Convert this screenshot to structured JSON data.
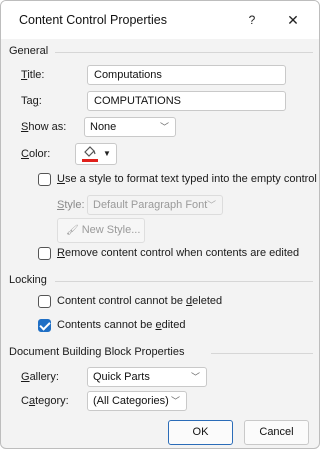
{
  "window": {
    "title": "Content Control Properties",
    "help_glyph": "?",
    "close_glyph": "✕"
  },
  "general": {
    "heading": "General",
    "title_label": {
      "u": "T",
      "rest": "itle:"
    },
    "title_value": "Computations",
    "tag_label": {
      "pre": "Ta",
      "u": "g",
      "rest": ":"
    },
    "tag_value": "COMPUTATIONS",
    "show_as_label": {
      "u": "S",
      "rest": "how as:"
    },
    "show_as_value": "None",
    "color_label": {
      "u": "C",
      "rest": "olor:"
    },
    "color_swatch": "#e0201b",
    "use_style_label": {
      "u": "U",
      "rest": "se a style to format text typed into the empty control"
    },
    "style_label": {
      "u": "S",
      "rest": "tyle:"
    },
    "style_value": "Default Paragraph Font",
    "new_style_label": {
      "u": "N",
      "rest": "ew Style..."
    },
    "remove_label": {
      "u": "R",
      "rest": "emove content control when contents are edited"
    }
  },
  "locking": {
    "heading": "Locking",
    "cannot_delete": {
      "pre": "Content control cannot be ",
      "u": "d",
      "rest": "eleted",
      "checked": false
    },
    "cannot_edit": {
      "pre": "Contents cannot be ",
      "u": "e",
      "rest": "dited",
      "checked": true
    }
  },
  "building_block": {
    "heading": "Document Building Block Properties",
    "gallery_label": {
      "u": "G",
      "rest": "allery:"
    },
    "gallery_value": "Quick Parts",
    "category_label": {
      "pre": "C",
      "u": "a",
      "rest": "tegory:"
    },
    "category_value": "(All Categories)"
  },
  "buttons": {
    "ok": "OK",
    "cancel": "Cancel"
  },
  "colors": {
    "accent": "#1f6fc5",
    "dialog_bg": "#f3f3f3"
  }
}
